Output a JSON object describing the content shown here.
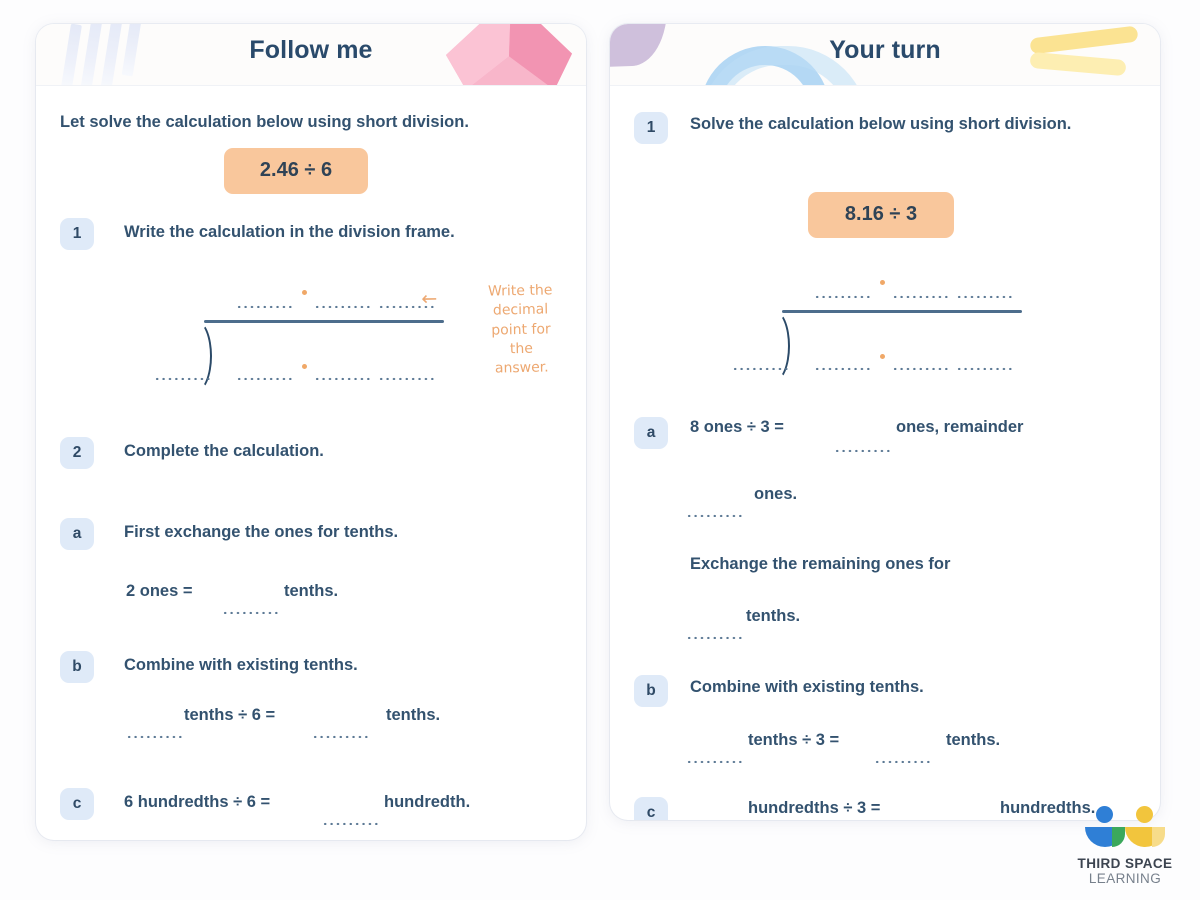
{
  "background_color": "#fdfdfe",
  "accent_colors": {
    "title_navy": "#2a4a6b",
    "body_navy": "#33526f",
    "badge_blue": "#dfeaf8",
    "calc_pill_orange": "#f9c79c",
    "handwriting_orange": "#eda871",
    "frame_line": "#4d6d8c",
    "decimal_dot": "#f0a868"
  },
  "left_card": {
    "title": "Follow me",
    "intro": "Let solve the calculation below using short division.",
    "calculation": "2.46 ÷ 6",
    "steps": [
      {
        "badge": "1",
        "text": "Write the calculation in the division frame."
      },
      {
        "badge": "2",
        "text": "Complete the calculation."
      },
      {
        "badge": "a",
        "text": "First exchange the ones for tenths."
      },
      {
        "badge": "b",
        "text": "Combine with existing tenths."
      },
      {
        "badge": "c",
        "text": ""
      }
    ],
    "answer_lines": {
      "a_line": {
        "prefix": "2 ones =",
        "suffix": "tenths."
      },
      "b_line": {
        "prefix": "",
        "middle": "tenths ÷ 6 =",
        "suffix": "tenths."
      },
      "c_line": {
        "prefix": "6 hundredths ÷ 6 =",
        "suffix": "hundredth."
      }
    },
    "note": {
      "arrow": "←",
      "line1": "Write the",
      "line2": "decimal",
      "line3": "point for",
      "line4": "the",
      "line5": "answer."
    }
  },
  "right_card": {
    "title": "Your turn",
    "steps": [
      {
        "badge": "1",
        "text": "Solve the calculation below using short division."
      },
      {
        "badge": "a",
        "text": ""
      },
      {
        "badge": "b",
        "text": "Combine with existing tenths."
      },
      {
        "badge": "c",
        "text": ""
      }
    ],
    "calculation": "8.16 ÷ 3",
    "answer_lines": {
      "a_line1": {
        "prefix": "8 ones ÷ 3 =",
        "suffix": "ones, remainder"
      },
      "a_line2": {
        "suffix": "ones."
      },
      "a_line3": {
        "text": "Exchange the remaining ones for"
      },
      "a_line4": {
        "suffix": "tenths."
      },
      "b_line": {
        "middle": "tenths ÷ 3 =",
        "suffix": "tenths."
      },
      "c_line": {
        "middle": "hundredths ÷ 3 =",
        "suffix": "hundredths."
      }
    }
  },
  "logo": {
    "line1": "THIRD SPACE",
    "line2": "LEARNING"
  }
}
